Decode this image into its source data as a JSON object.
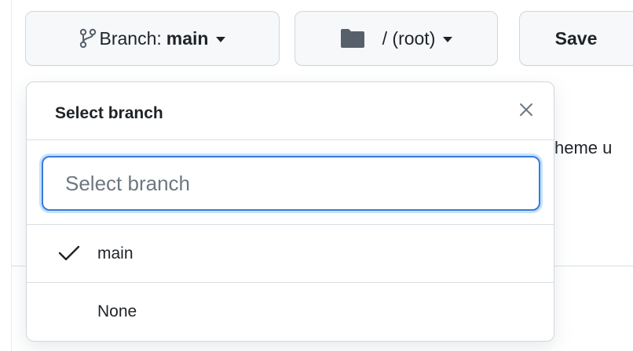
{
  "toolbar": {
    "branch_prefix": "Branch:",
    "branch_name": "main",
    "folder_label": "/ (root)",
    "save_label": "Save"
  },
  "background": {
    "partial_text": "heme u"
  },
  "dropdown": {
    "title": "Select branch",
    "filter_placeholder": "Select branch",
    "filter_value": "",
    "items": [
      {
        "label": "main",
        "selected": true
      },
      {
        "label": "None",
        "selected": false
      }
    ]
  },
  "colors": {
    "button_bg": "#f6f8fa",
    "border": "#d0d7de",
    "focus_ring": "#3b79d8",
    "text": "#1f2328",
    "icon_gray": "#57606a"
  },
  "icons": {
    "branch": "git-branch-icon",
    "folder": "folder-icon",
    "close": "close-icon",
    "check": "check-icon",
    "caret": "triangle-down-icon"
  }
}
